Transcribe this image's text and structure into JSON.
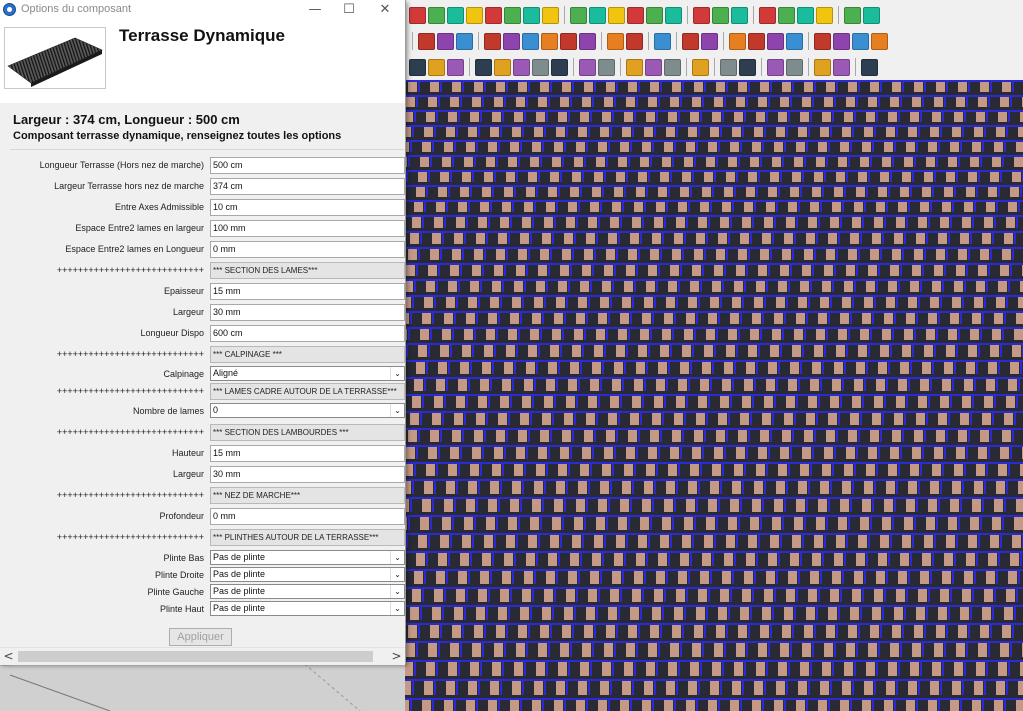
{
  "window": {
    "title": "Options du composant",
    "minimize": "—",
    "maximize": "☐",
    "close": "✕"
  },
  "header": {
    "component_title": "Terrasse Dynamique"
  },
  "summary": {
    "dimensions": "Largeur : 374 cm, Longueur : 500 cm",
    "description": "Composant terrasse dynamique, renseignez toutes les options"
  },
  "form": {
    "rows": [
      {
        "kind": "input",
        "label": "Longueur Terrasse (Hors nez de marche)",
        "value": "500 cm"
      },
      {
        "kind": "input",
        "label": "Largeur Terrasse hors nez de marche",
        "value": "374 cm"
      },
      {
        "kind": "input",
        "label": "Entre Axes Admissible",
        "value": "10 cm"
      },
      {
        "kind": "input",
        "label": "Espace Entre2 lames en largeur",
        "value": "100 mm"
      },
      {
        "kind": "input",
        "label": "Espace Entre2 lames en Longueur",
        "value": "0 mm"
      },
      {
        "kind": "section",
        "label": "++++++++++++++++++++++++++++",
        "value": "*** SECTION DES LAMES***"
      },
      {
        "kind": "input",
        "label": "Epaisseur",
        "value": "15 mm"
      },
      {
        "kind": "input",
        "label": "Largeur",
        "value": "30 mm"
      },
      {
        "kind": "input",
        "label": "Longueur Dispo",
        "value": "600 cm"
      },
      {
        "kind": "section",
        "label": "++++++++++++++++++++++++++++",
        "value": "*** CALPINAGE ***"
      },
      {
        "kind": "select",
        "label": "Calpinage",
        "value": "Aligné"
      },
      {
        "kind": "section",
        "label": "++++++++++++++++++++++++++++",
        "value": "*** LAMES CADRE AUTOUR DE LA TERRASSE***"
      },
      {
        "kind": "select",
        "label": "Nombre de lames",
        "value": "0"
      },
      {
        "kind": "section",
        "label": "++++++++++++++++++++++++++++",
        "value": "*** SECTION DES LAMBOURDES ***"
      },
      {
        "kind": "input",
        "label": "Hauteur",
        "value": "15 mm"
      },
      {
        "kind": "input",
        "label": "Largeur",
        "value": "30 mm"
      },
      {
        "kind": "section",
        "label": "++++++++++++++++++++++++++++",
        "value": "*** NEZ DE MARCHE***"
      },
      {
        "kind": "input",
        "label": "Profondeur",
        "value": "0 mm"
      },
      {
        "kind": "section",
        "label": "++++++++++++++++++++++++++++",
        "value": "*** PLINTHES AUTOUR DE LA TERRASSE***"
      },
      {
        "kind": "select",
        "label": "Plinte Bas",
        "value": "Pas de plinte"
      },
      {
        "kind": "select",
        "label": "Plinte Droite",
        "value": "Pas de plinte"
      },
      {
        "kind": "select",
        "label": "Plinte Gauche",
        "value": "Pas de plinte"
      },
      {
        "kind": "select",
        "label": "Plinte Haut",
        "value": "Pas de plinte"
      }
    ]
  },
  "footer": {
    "apply_label": "Appliquer"
  },
  "scrollbar": {
    "left_arrow": "<",
    "right_arrow": ">"
  },
  "colors": {
    "board_wood": "#c49a86",
    "joist_blue": "#2b2bd6",
    "gap_shadow": "#2a2a34",
    "apply_disabled_text": "#a0a0a0"
  },
  "icons": {
    "app": "sketchup-component-icon",
    "select_arrow": "chevron-down-icon"
  }
}
